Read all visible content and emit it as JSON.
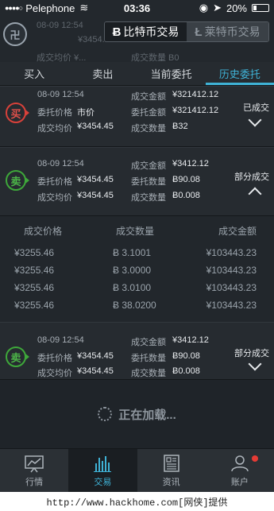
{
  "status_bar": {
    "signal": "●●●●○",
    "carrier": "Pelephone",
    "wifi": "≋",
    "time": "03:36",
    "battery": "20%"
  },
  "header": {
    "logo_glyph": "卍",
    "ghost_lines": [
      "08-09 12:54",
      "¥3454...",
      "成交均价  ¥...",
      "成交数量  B0"
    ],
    "segments": [
      {
        "icon": "Ƀ",
        "label": "比特币交易",
        "active": true
      },
      {
        "icon": "Ł",
        "label": "莱特币交易",
        "active": false
      }
    ]
  },
  "tabs": [
    "买入",
    "卖出",
    "当前委托",
    "历史委托"
  ],
  "active_tab_index": 3,
  "orders": [
    {
      "side": "买",
      "side_type": "buy",
      "time": "08-09 12:54",
      "deal_amount_label": "成交金额",
      "deal_amount": "¥321412.12",
      "price_label": "委托价格",
      "price": "市价",
      "amount_label": "委托金额",
      "amount": "¥321412.12",
      "avg_label": "成交均价",
      "avg": "¥3454.45",
      "qty_label": "成交数量",
      "qty": "Ƀ32",
      "status": "已成交",
      "expanded": false
    },
    {
      "side": "卖",
      "side_type": "sell",
      "time": "08-09 12:54",
      "deal_amount_label": "成交金额",
      "deal_amount": "¥3412.12",
      "price_label": "委托价格",
      "price": "¥3454.45",
      "amount_label": "委托数量",
      "amount": "Ƀ90.08",
      "avg_label": "成交均价",
      "avg": "¥3454.45",
      "qty_label": "成交数量",
      "qty": "Ƀ0.008",
      "status": "部分成交",
      "expanded": true
    },
    {
      "side": "卖",
      "side_type": "sell",
      "time": "08-09 12:54",
      "deal_amount_label": "成交金额",
      "deal_amount": "¥3412.12",
      "price_label": "委托价格",
      "price": "¥3454.45",
      "amount_label": "委托数量",
      "amount": "Ƀ90.08",
      "avg_label": "成交均价",
      "avg": "¥3454.45",
      "qty_label": "成交数量",
      "qty": "Ƀ0.008",
      "status": "部分成交",
      "expanded": false
    }
  ],
  "fills": {
    "headers": [
      "成交价格",
      "成交数量",
      "成交金额"
    ],
    "rows": [
      [
        "¥3255.46",
        "Ƀ 3.1001",
        "¥103443.23"
      ],
      [
        "¥3255.46",
        "Ƀ 3.0000",
        "¥103443.23"
      ],
      [
        "¥3255.46",
        "Ƀ 3.0100",
        "¥103443.23"
      ],
      [
        "¥3255.46",
        "Ƀ 38.0200",
        "¥103443.23"
      ]
    ]
  },
  "loading_text": "正在加载...",
  "bottom_nav": [
    {
      "icon": "chart-icon",
      "label": "行情"
    },
    {
      "icon": "bars-icon",
      "label": "交易"
    },
    {
      "icon": "news-icon",
      "label": "资讯"
    },
    {
      "icon": "user-icon",
      "label": "账户"
    }
  ],
  "active_nav_index": 1,
  "watermark": "http://www.hackhome.com[网侠]提供",
  "colors": {
    "accent": "#3fb2d6",
    "buy": "#d8413a",
    "sell": "#3ea83a",
    "notify": "#e53b35"
  }
}
